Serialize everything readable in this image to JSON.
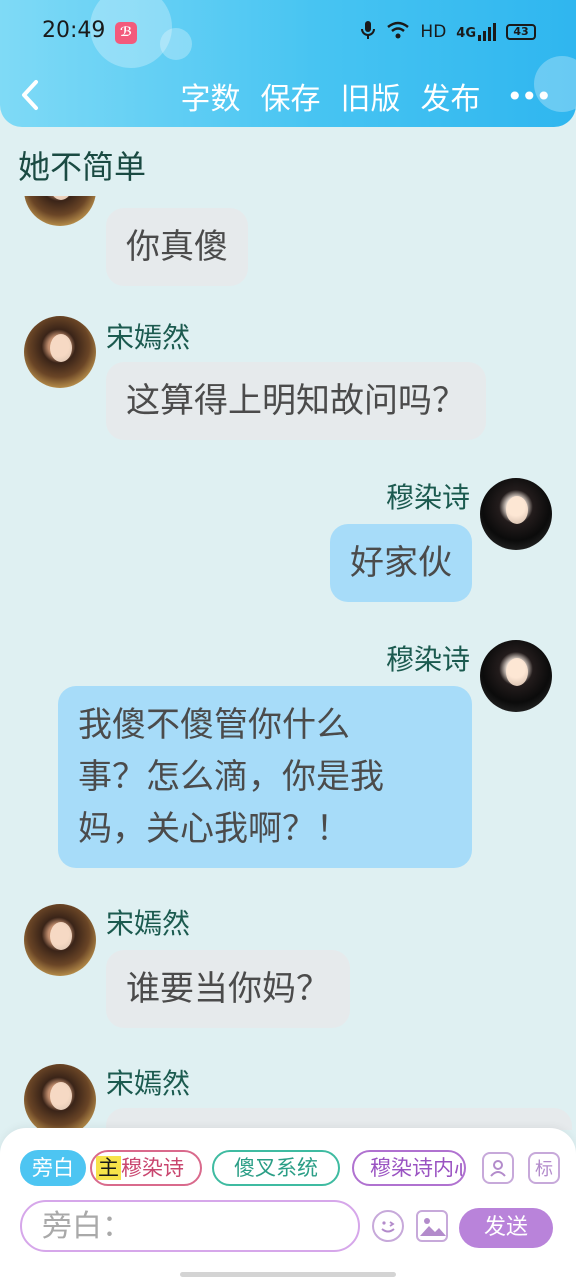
{
  "status_bar": {
    "time": "20:49",
    "app_badge": "🎦",
    "network_hd": "HD",
    "network_gen": "4G",
    "battery": "43"
  },
  "nav": {
    "back_icon": "chevron-left-icon",
    "word_count": "字数",
    "save": "保存",
    "old_version": "旧版",
    "publish": "发布",
    "more": "•••"
  },
  "doc_title": "她不简单",
  "messages": [
    {
      "sender": "",
      "side": "left",
      "text": "你真傻",
      "avatar": "song-yanran"
    },
    {
      "sender": "宋嫣然",
      "side": "left",
      "text": "这算得上明知故问吗？",
      "avatar": "song-yanran"
    },
    {
      "sender": "穆染诗",
      "side": "right",
      "text": "好家伙",
      "avatar": "mu-ranshi"
    },
    {
      "sender": "穆染诗",
      "side": "right",
      "text_lines": [
        "我傻不傻管你什么",
        "事？怎么滴，你是我",
        "妈，关心我啊？！"
      ],
      "avatar": "mu-ranshi"
    },
    {
      "sender": "宋嫣然",
      "side": "left",
      "text": "谁要当你妈？",
      "avatar": "song-yanran"
    },
    {
      "sender": "宋嫣然",
      "side": "left",
      "text": "",
      "avatar": "song-yanran"
    }
  ],
  "panel": {
    "chips": {
      "narration": "旁白",
      "main_prefix": "主",
      "main_name": "穆染诗",
      "system": "傻叉系统",
      "inner": "穆染诗内心"
    },
    "icons": {
      "character": "person-card-icon",
      "tag": "标"
    },
    "input_placeholder": "旁白：",
    "send": "发送"
  },
  "colors": {
    "header_gradient": [
      "#7fdaf6",
      "#2fb6ef"
    ],
    "background": "#dff0f2",
    "my_bubble": "#a7dcf9",
    "other_bubble": "#e6eaec",
    "send_button": "#b983da"
  }
}
